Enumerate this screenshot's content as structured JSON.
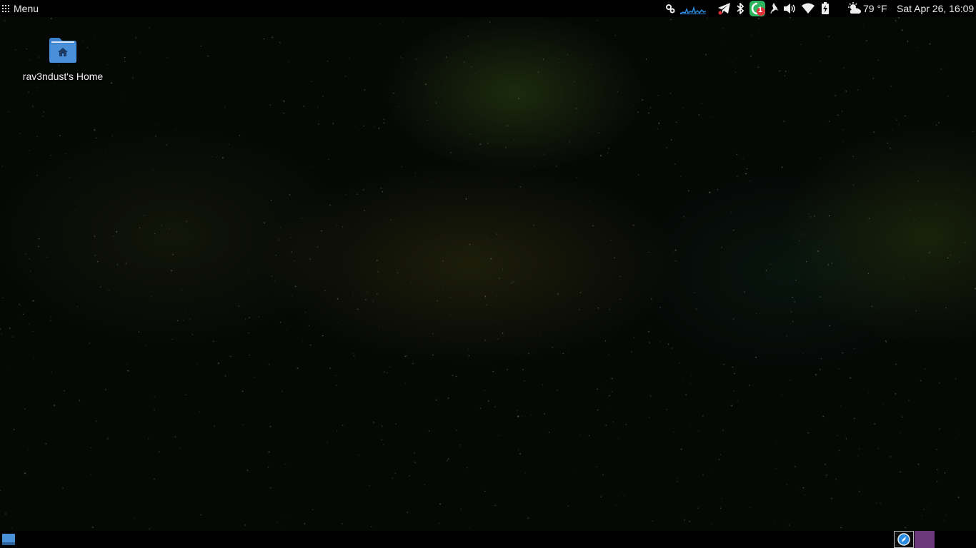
{
  "top_panel": {
    "menu_label": "Menu",
    "tray_icons": [
      "settings-gear-icon",
      "system-monitor-graph-icon",
      "telegram-icon",
      "bluetooth-icon",
      "notification-app-icon",
      "flame-icon",
      "volume-icon",
      "wifi-icon",
      "battery-charging-icon",
      "weather-partly-sunny-icon"
    ],
    "notification_badge": "1",
    "weather_temp": "79 °F",
    "clock": "Sat Apr 26, 16:09"
  },
  "desktop": {
    "icons": [
      {
        "name": "home-folder-icon",
        "label": "rav3ndust's Home"
      }
    ]
  },
  "bottom_panel": {
    "show_desktop_icon": "show-desktop-icon",
    "workspaces": [
      "workspace-1",
      "workspace-2"
    ]
  },
  "colors": {
    "panel_bg": "#000000",
    "folder_blue": "#4a90d9",
    "workspace_active": "#6a3a7d",
    "sysmon_blue": "#2a8ce0",
    "badge_red": "#e0303a",
    "app_green": "#2fb560"
  }
}
